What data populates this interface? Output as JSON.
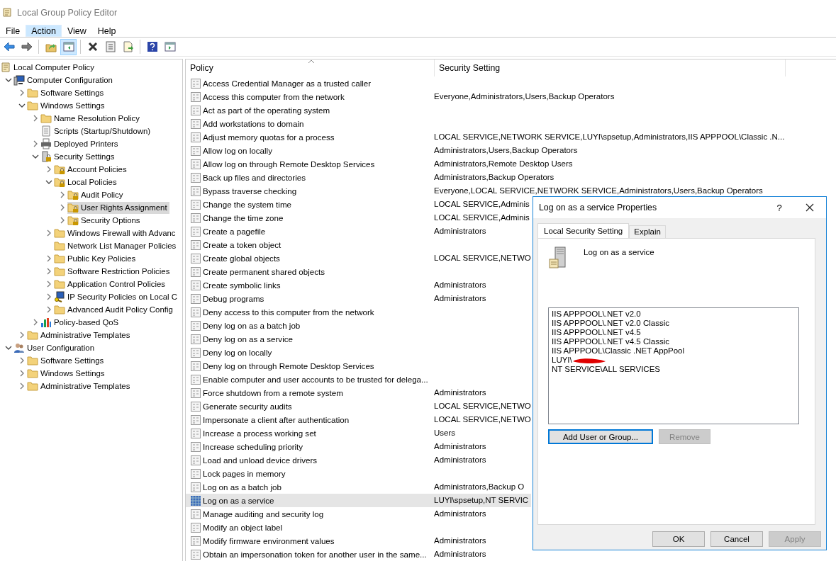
{
  "window": {
    "title": "Local Group Policy Editor"
  },
  "menu": [
    {
      "label": "File",
      "selected": false
    },
    {
      "label": "Action",
      "selected": true
    },
    {
      "label": "View",
      "selected": false
    },
    {
      "label": "Help",
      "selected": false
    }
  ],
  "toolbar": [
    [
      {
        "kind": "back",
        "pressed": false
      },
      {
        "kind": "forward",
        "pressed": false
      }
    ],
    [
      {
        "kind": "up",
        "pressed": false
      },
      {
        "kind": "tree",
        "pressed": true
      }
    ],
    [
      {
        "kind": "delete",
        "pressed": false
      },
      {
        "kind": "properties",
        "pressed": false
      },
      {
        "kind": "export",
        "pressed": false
      }
    ],
    [
      {
        "kind": "help",
        "pressed": false
      },
      {
        "kind": "actionpane",
        "pressed": false
      }
    ]
  ],
  "tree": [
    {
      "label": "Local Computer Policy",
      "kind": "scroll",
      "selected": false,
      "children": [
        {
          "label": "Computer Configuration",
          "kind": "computer",
          "expanded": true,
          "selected": false,
          "children": [
            {
              "label": "Software Settings",
              "kind": "folder",
              "expanded": false,
              "selected": false
            },
            {
              "label": "Windows Settings",
              "kind": "folder",
              "expanded": true,
              "selected": false,
              "children": [
                {
                  "label": "Name Resolution Policy",
                  "kind": "folder",
                  "expanded": false,
                  "selected": false
                },
                {
                  "label": "Scripts (Startup/Shutdown)",
                  "kind": "script",
                  "selected": false
                },
                {
                  "label": "Deployed Printers",
                  "kind": "printer",
                  "expanded": false,
                  "selected": false
                },
                {
                  "label": "Security Settings",
                  "kind": "server",
                  "expanded": true,
                  "selected": false,
                  "children": [
                    {
                      "label": "Account Policies",
                      "kind": "lockfolder",
                      "expanded": false,
                      "selected": false
                    },
                    {
                      "label": "Local Policies",
                      "kind": "lockfolder",
                      "expanded": true,
                      "selected": false,
                      "children": [
                        {
                          "label": "Audit Policy",
                          "kind": "lockfolder",
                          "expanded": false,
                          "selected": false
                        },
                        {
                          "label": "User Rights Assignment",
                          "kind": "lockfolder",
                          "expanded": false,
                          "selected": true
                        },
                        {
                          "label": "Security Options",
                          "kind": "lockfolder",
                          "expanded": false,
                          "selected": false
                        }
                      ]
                    },
                    {
                      "label": "Windows Firewall with Advanc",
                      "kind": "folder",
                      "expanded": false,
                      "selected": false
                    },
                    {
                      "label": "Network List Manager Policies",
                      "kind": "folder",
                      "selected": false
                    },
                    {
                      "label": "Public Key Policies",
                      "kind": "folder",
                      "expanded": false,
                      "selected": false
                    },
                    {
                      "label": "Software Restriction Policies",
                      "kind": "folder",
                      "expanded": false,
                      "selected": false
                    },
                    {
                      "label": "Application Control Policies",
                      "kind": "folder",
                      "expanded": false,
                      "selected": false
                    },
                    {
                      "label": "IP Security Policies on Local C",
                      "kind": "ipsec",
                      "expanded": false,
                      "selected": false
                    },
                    {
                      "label": "Advanced Audit Policy Config",
                      "kind": "folder",
                      "expanded": false,
                      "selected": false
                    }
                  ]
                },
                {
                  "label": "Policy-based QoS",
                  "kind": "chart",
                  "expanded": false,
                  "selected": false
                }
              ]
            },
            {
              "label": "Administrative Templates",
              "kind": "folder",
              "expanded": false,
              "selected": false
            }
          ]
        },
        {
          "label": "User Configuration",
          "kind": "user",
          "expanded": true,
          "selected": false,
          "children": [
            {
              "label": "Software Settings",
              "kind": "folder",
              "expanded": false,
              "selected": false
            },
            {
              "label": "Windows Settings",
              "kind": "folder",
              "expanded": false,
              "selected": false
            },
            {
              "label": "Administrative Templates",
              "kind": "folder",
              "expanded": false,
              "selected": false
            }
          ]
        }
      ]
    }
  ],
  "table": {
    "columns": [
      "Policy",
      "Security Setting"
    ],
    "rows": [
      {
        "policy": "Access Credential Manager as a trusted caller",
        "setting": "",
        "selected": false
      },
      {
        "policy": "Access this computer from the network",
        "setting": "Everyone,Administrators,Users,Backup Operators",
        "selected": false
      },
      {
        "policy": "Act as part of the operating system",
        "setting": "",
        "selected": false
      },
      {
        "policy": "Add workstations to domain",
        "setting": "",
        "selected": false
      },
      {
        "policy": "Adjust memory quotas for a process",
        "setting": "LOCAL SERVICE,NETWORK SERVICE,LUYI\\spsetup,Administrators,IIS APPPOOL\\Classic .N...",
        "selected": false
      },
      {
        "policy": "Allow log on locally",
        "setting": "Administrators,Users,Backup Operators",
        "selected": false
      },
      {
        "policy": "Allow log on through Remote Desktop Services",
        "setting": "Administrators,Remote Desktop Users",
        "selected": false
      },
      {
        "policy": "Back up files and directories",
        "setting": "Administrators,Backup Operators",
        "selected": false
      },
      {
        "policy": "Bypass traverse checking",
        "setting": "Everyone,LOCAL SERVICE,NETWORK SERVICE,Administrators,Users,Backup Operators",
        "selected": false
      },
      {
        "policy": "Change the system time",
        "setting": "LOCAL SERVICE,Adminis",
        "selected": false
      },
      {
        "policy": "Change the time zone",
        "setting": "LOCAL SERVICE,Adminis",
        "selected": false
      },
      {
        "policy": "Create a pagefile",
        "setting": "Administrators",
        "selected": false
      },
      {
        "policy": "Create a token object",
        "setting": "",
        "selected": false
      },
      {
        "policy": "Create global objects",
        "setting": "LOCAL SERVICE,NETWO",
        "selected": false
      },
      {
        "policy": "Create permanent shared objects",
        "setting": "",
        "selected": false
      },
      {
        "policy": "Create symbolic links",
        "setting": "Administrators",
        "selected": false
      },
      {
        "policy": "Debug programs",
        "setting": "Administrators",
        "selected": false
      },
      {
        "policy": "Deny access to this computer from the network",
        "setting": "",
        "selected": false
      },
      {
        "policy": "Deny log on as a batch job",
        "setting": "",
        "selected": false
      },
      {
        "policy": "Deny log on as a service",
        "setting": "",
        "selected": false
      },
      {
        "policy": "Deny log on locally",
        "setting": "",
        "selected": false
      },
      {
        "policy": "Deny log on through Remote Desktop Services",
        "setting": "",
        "selected": false
      },
      {
        "policy": "Enable computer and user accounts to be trusted for delega...",
        "setting": "",
        "selected": false
      },
      {
        "policy": "Force shutdown from a remote system",
        "setting": "Administrators",
        "selected": false
      },
      {
        "policy": "Generate security audits",
        "setting": "LOCAL SERVICE,NETWO",
        "selected": false
      },
      {
        "policy": "Impersonate a client after authentication",
        "setting": "LOCAL SERVICE,NETWO",
        "selected": false
      },
      {
        "policy": "Increase a process working set",
        "setting": "Users",
        "selected": false
      },
      {
        "policy": "Increase scheduling priority",
        "setting": "Administrators",
        "selected": false
      },
      {
        "policy": "Load and unload device drivers",
        "setting": "Administrators",
        "selected": false
      },
      {
        "policy": "Lock pages in memory",
        "setting": "",
        "selected": false
      },
      {
        "policy": "Log on as a batch job",
        "setting": "Administrators,Backup O",
        "selected": false
      },
      {
        "policy": "Log on as a service",
        "setting": "LUYI\\spsetup,NT SERVIC",
        "selected": true
      },
      {
        "policy": "Manage auditing and security log",
        "setting": "Administrators",
        "selected": false
      },
      {
        "policy": "Modify an object label",
        "setting": "",
        "selected": false
      },
      {
        "policy": "Modify firmware environment values",
        "setting": "Administrators",
        "selected": false
      },
      {
        "policy": "Obtain an impersonation token for another user in the same...",
        "setting": "Administrators",
        "selected": false
      }
    ]
  },
  "dialog": {
    "title": "Log on as a service Properties",
    "help": "?",
    "tabs": [
      {
        "label": "Local Security Setting",
        "selected": true
      },
      {
        "label": "Explain",
        "selected": false
      }
    ],
    "heading": "Log on as a service",
    "entries": [
      {
        "text": "IIS APPPOOL\\.NET v2.0",
        "redacted": false
      },
      {
        "text": "IIS APPPOOL\\.NET v2.0 Classic",
        "redacted": false
      },
      {
        "text": "IIS APPPOOL\\.NET v4.5",
        "redacted": false
      },
      {
        "text": "IIS APPPOOL\\.NET v4.5 Classic",
        "redacted": false
      },
      {
        "text": "IIS APPPOOL\\Classic .NET AppPool",
        "redacted": false
      },
      {
        "text": "LUYI\\",
        "redacted": true
      },
      {
        "text": "NT SERVICE\\ALL SERVICES",
        "redacted": false
      }
    ],
    "list_buttons": [
      {
        "label": "Add User or Group...",
        "disabled": false,
        "focused": true
      },
      {
        "label": "Remove",
        "disabled": true,
        "focused": false
      }
    ],
    "buttons": [
      {
        "label": "OK",
        "disabled": false,
        "focused": false
      },
      {
        "label": "Cancel",
        "disabled": false,
        "focused": false
      },
      {
        "label": "Apply",
        "disabled": true,
        "focused": false
      }
    ]
  }
}
